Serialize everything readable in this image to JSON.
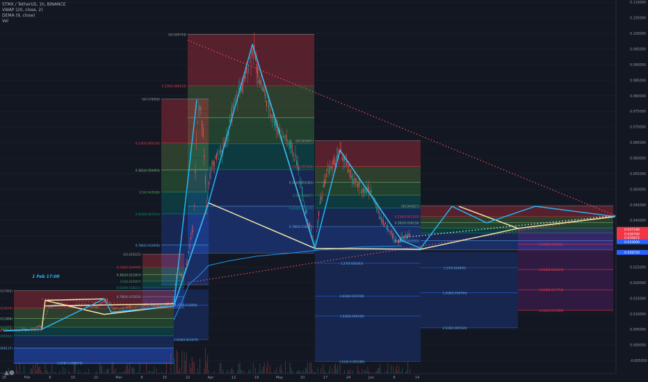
{
  "header": {
    "symbol": "STMX / TetherUS, 1h, BINANCE",
    "ind1": "VWAP (20, close, 2)",
    "ind2": "DEMA (9, close)",
    "ind3": "Vol"
  },
  "chart_data": {
    "type": "candlestick",
    "pair": "STMX / TetherUS",
    "interval": "1h",
    "exchange": "BINANCE",
    "ylim": [
      -0.007,
      0.1105
    ],
    "y_ticks": [
      "0.110000",
      "0.105000",
      "0.100000",
      "0.095000",
      "0.090000",
      "0.085000",
      "0.080000",
      "0.075000",
      "0.070000",
      "0.065000",
      "0.060000",
      "0.055000",
      "0.050000",
      "0.045000",
      "0.040000",
      "0.035000",
      "0.030000",
      "0.025000",
      "0.020000",
      "0.015000",
      "0.010000",
      "0.005000",
      "0.000000",
      "-0.005000"
    ],
    "x_ticks": [
      "25",
      "Feb",
      "8",
      "15",
      "22",
      "Mar",
      "8",
      "15",
      "22",
      "Apr",
      "12",
      "19",
      "May",
      "10",
      "17",
      "24",
      "Jun",
      "8",
      "14"
    ],
    "annotation": "1 Feb 17:00",
    "price_tags": [
      {
        "text": "0.037189",
        "value": 0.0371,
        "color": "#f23645"
      },
      {
        "text": "0.036700",
        "value": 0.0357,
        "color": "#f23645"
      },
      {
        "text": "0.035872",
        "value": 0.0344,
        "color": "#f23645"
      },
      {
        "text": "0.033000",
        "value": 0.0331,
        "color": "#2962ff"
      },
      {
        "text": "0.028720",
        "value": 0.0297,
        "color": "#2962ff"
      }
    ],
    "price_path": [
      [
        0,
        0.005
      ],
      [
        22,
        0.0048
      ],
      [
        44,
        0.0052
      ],
      [
        60,
        0.006
      ],
      [
        70,
        0.012
      ],
      [
        85,
        0.0135
      ],
      [
        100,
        0.0125
      ],
      [
        120,
        0.013
      ],
      [
        140,
        0.012
      ],
      [
        152,
        0.0148
      ],
      [
        165,
        0.0115
      ],
      [
        185,
        0.0122
      ],
      [
        210,
        0.0128
      ],
      [
        235,
        0.0125
      ],
      [
        248,
        0.0135
      ],
      [
        256,
        0.025
      ],
      [
        263,
        0.021
      ],
      [
        270,
        0.028
      ],
      [
        278,
        0.038
      ],
      [
        283,
        0.067
      ],
      [
        287,
        0.078
      ],
      [
        292,
        0.069
      ],
      [
        297,
        0.045
      ],
      [
        302,
        0.055
      ],
      [
        310,
        0.06
      ],
      [
        320,
        0.062
      ],
      [
        330,
        0.07
      ],
      [
        340,
        0.08
      ],
      [
        350,
        0.084
      ],
      [
        358,
        0.09
      ],
      [
        364,
        0.096
      ],
      [
        370,
        0.088
      ],
      [
        378,
        0.082
      ],
      [
        388,
        0.076
      ],
      [
        398,
        0.07
      ],
      [
        408,
        0.067
      ],
      [
        418,
        0.064
      ],
      [
        428,
        0.058
      ],
      [
        438,
        0.045
      ],
      [
        446,
        0.038
      ],
      [
        453,
        0.031
      ],
      [
        460,
        0.045
      ],
      [
        470,
        0.055
      ],
      [
        480,
        0.058
      ],
      [
        489,
        0.062
      ],
      [
        498,
        0.058
      ],
      [
        508,
        0.053
      ],
      [
        520,
        0.05
      ],
      [
        532,
        0.05
      ],
      [
        540,
        0.045
      ],
      [
        548,
        0.041
      ],
      [
        556,
        0.038
      ],
      [
        565,
        0.035
      ],
      [
        572,
        0.033
      ],
      [
        580,
        0.0345
      ],
      [
        590,
        0.035
      ]
    ],
    "vwap_path": [
      [
        250,
        0.008
      ],
      [
        262,
        0.014
      ],
      [
        272,
        0.0195
      ],
      [
        285,
        0.022
      ],
      [
        300,
        0.0255
      ],
      [
        330,
        0.027
      ],
      [
        370,
        0.0285
      ],
      [
        420,
        0.0295
      ],
      [
        460,
        0.0305
      ],
      [
        520,
        0.0315
      ],
      [
        578,
        0.0318
      ]
    ],
    "wave_lines": [
      {
        "color": "#f0e6a8",
        "points": [
          [
            5,
            0.0045
          ],
          [
            60,
            0.005
          ],
          [
            65,
            0.0143
          ],
          [
            150,
            0.0098
          ],
          [
            250,
            0.0125
          ],
          [
            300,
            0.0456
          ],
          [
            453,
            0.031
          ],
          [
            605,
            0.0307
          ],
          [
            745,
            0.0374
          ],
          [
            885,
            0.0412
          ]
        ]
      },
      {
        "color": "#f0e6a8",
        "points": [
          [
            363,
            0.0965
          ],
          [
            453,
            0.031
          ]
        ]
      },
      {
        "color": "#f0e6a8",
        "points": [
          [
            489,
            0.0625
          ],
          [
            578,
            0.0335
          ]
        ]
      },
      {
        "color": "#f0e6a8",
        "points": [
          [
            660,
            0.0445
          ],
          [
            745,
            0.0374
          ],
          [
            885,
            0.0412
          ]
        ]
      },
      {
        "color": "#f0e6a8",
        "points": [
          [
            65,
            0.0143
          ],
          [
            150,
            0.0148
          ]
        ]
      },
      {
        "color": "#f0e6a8",
        "points": [
          [
            65,
            0.0125
          ],
          [
            250,
            0.0132
          ]
        ]
      },
      {
        "color": "#29b6f6",
        "points": [
          [
            5,
            0.0045
          ],
          [
            60,
            0.005
          ],
          [
            150,
            0.0148
          ],
          [
            160,
            0.0105
          ],
          [
            250,
            0.0125
          ],
          [
            300,
            0.0456
          ],
          [
            363,
            0.0965
          ],
          [
            453,
            0.031
          ]
        ]
      },
      {
        "color": "#29b6f6",
        "points": [
          [
            453,
            0.031
          ],
          [
            489,
            0.0625
          ],
          [
            578,
            0.0335
          ],
          [
            605,
            0.031
          ],
          [
            650,
            0.0445
          ],
          [
            700,
            0.0392
          ],
          [
            770,
            0.0445
          ],
          [
            885,
            0.0412
          ]
        ]
      },
      {
        "color": "#29b6f6",
        "points": [
          [
            250,
            0.0125
          ],
          [
            283,
            0.0787
          ]
        ]
      }
    ],
    "trend_lines": [
      {
        "points": [
          [
            270,
            0.0978
          ],
          [
            885,
            0.0415
          ]
        ],
        "color": "#f7525f"
      },
      {
        "points": [
          [
            270,
            0.02
          ],
          [
            885,
            0.0415
          ]
        ],
        "color": "#f7525f"
      },
      {
        "points": [
          [
            0,
            0.0045
          ],
          [
            60,
            0.0045
          ]
        ],
        "color": "#f7525f"
      },
      {
        "points": [
          [
            60,
            0.0148
          ],
          [
            250,
            0.0122
          ]
        ],
        "color": "#f7525f"
      },
      {
        "points": [
          [
            580,
            0.0345
          ],
          [
            885,
            0.0415
          ]
        ],
        "color": "#ffffff"
      }
    ],
    "fib_retracements": [
      {
        "x0": 270,
        "x1": 452,
        "hi": 0.0997,
        "lo": 0.0295,
        "levels": [
          {
            "r": 0,
            "label": "0(0.099748)"
          },
          {
            "r": 0.236,
            "label": "0.236(0.086193)"
          },
          {
            "r": 0.382,
            "label": ""
          },
          {
            "r": 0.5,
            "label": ""
          },
          {
            "r": 0.618,
            "label": ""
          },
          {
            "r": 0.786,
            "label": ""
          },
          {
            "r": 1,
            "label": ""
          }
        ]
      },
      {
        "x0": 232,
        "x1": 300,
        "hi": 0.0789,
        "lo": 0.0193,
        "levels": [
          {
            "r": 0,
            "label": "0(0.078908)"
          },
          {
            "r": 0.236,
            "label": "0.236(0.065139)"
          },
          {
            "r": 0.382,
            "label": "0.382(0.056493)"
          },
          {
            "r": 0.5,
            "label": "0.5(0.049588)"
          },
          {
            "r": 0.618,
            "label": "0.618(0.042533)"
          },
          {
            "r": 0.786,
            "label": "0.786(0.032608)"
          },
          {
            "r": 1,
            "label": ""
          }
        ]
      },
      {
        "x0": 205,
        "x1": 265,
        "hi": 0.0291,
        "lo": 0.0118,
        "levels": [
          {
            "r": 0,
            "label": "0(0.029225)"
          },
          {
            "r": 0.236,
            "label": "0.236(0.024449)"
          },
          {
            "r": 0.382,
            "label": "0.382(0.021507)"
          },
          {
            "r": 0.5,
            "label": "0.5(0.020097)"
          },
          {
            "r": 0.618,
            "label": "0.618(0.018221)"
          },
          {
            "r": 0.786,
            "label": "0.786(0.015656)"
          },
          {
            "r": 1,
            "label": ""
          }
        ]
      },
      {
        "x0": 20,
        "x1": 250,
        "hi": 0.0174,
        "lo": -0.006,
        "levels": [
          {
            "r": 0,
            "label": "0(0.017482)"
          },
          {
            "r": 0.236,
            "label": "0.236(0.014076)"
          },
          {
            "r": 0.382,
            "label": "0.382(0.011968)"
          },
          {
            "r": 0.5,
            "label": "0.5(0.010265)"
          },
          {
            "r": 0.618,
            "label": "0.618(0.008562)"
          },
          {
            "r": 0.786,
            "label": "0.786(0.006137)"
          },
          {
            "r": 1,
            "label": ""
          }
        ]
      },
      {
        "x0": 453,
        "x1": 605,
        "hi": 0.0656,
        "lo": 0.0305,
        "levels": [
          {
            "r": 0,
            "label": "0(0.065667)"
          },
          {
            "r": 0.236,
            "label": "0.236(0.057459)"
          },
          {
            "r": 0.382,
            "label": "0.382(0.052361)"
          },
          {
            "r": 0.5,
            "label": "0.5(0.048247)"
          },
          {
            "r": 0.618,
            "label": "0.618(0.044145)"
          },
          {
            "r": 0.786,
            "label": "0.786(0.038293)"
          },
          {
            "r": 1,
            "label": ""
          }
        ]
      },
      {
        "x0": 605,
        "x1": 882,
        "hi": 0.0446,
        "lo": 0.0305,
        "levels": [
          {
            "r": 0,
            "label": "0(0.044627)"
          },
          {
            "r": 0.236,
            "label": "0.236(0.041295)"
          },
          {
            "r": 0.382,
            "label": "0.382(0.039218)"
          },
          {
            "r": 0.5,
            "label": ""
          },
          {
            "r": 0.618,
            "label": ""
          },
          {
            "r": 0.786,
            "label": "0.786(0.033555)"
          },
          {
            "r": 1,
            "label": ""
          }
        ]
      }
    ],
    "fib_extensions": [
      {
        "x0": 20,
        "x1": 250,
        "color": "#2962ff",
        "levels": [
          {
            "value": -0.0058,
            "label": "1.618(-0.005875)"
          }
        ]
      },
      {
        "x0": 250,
        "x1": 300,
        "color": "#2962ff",
        "levels": [
          {
            "value": 0.0128,
            "label": "1.27(0.012856)"
          },
          {
            "value": 0.0017,
            "label": "1.618(0.001679)"
          }
        ]
      },
      {
        "x0": 453,
        "x1": 605,
        "color": "#2962ff",
        "levels": [
          {
            "value": 0.0262,
            "label": "1.27(0.026263)"
          },
          {
            "value": 0.0157,
            "label": "1.618(0.015769)"
          },
          {
            "value": 0.0093,
            "label": "1.618(0.009330)"
          },
          {
            "value": -0.0053,
            "label": "1.618(-0.005289)"
          }
        ]
      },
      {
        "x0": 605,
        "x1": 745,
        "color": "#2962ff",
        "levels": [
          {
            "value": 0.0248,
            "label": "1.27(0.024845)"
          },
          {
            "value": 0.0167,
            "label": "1.618(0.016744)"
          },
          {
            "value": 0.0055,
            "label": "2.618(0.005530)"
          }
        ]
      },
      {
        "x0": 745,
        "x1": 882,
        "color": "#9c27b0",
        "levels": [
          {
            "value": 0.0324,
            "label": "1.618(0.032431)"
          },
          {
            "value": 0.0242,
            "label": "2.618(0.024203)"
          },
          {
            "value": 0.0177,
            "label": "3.618(0.017754)"
          },
          {
            "value": 0.0111,
            "label": "4.236(0.011099)"
          }
        ]
      }
    ]
  }
}
